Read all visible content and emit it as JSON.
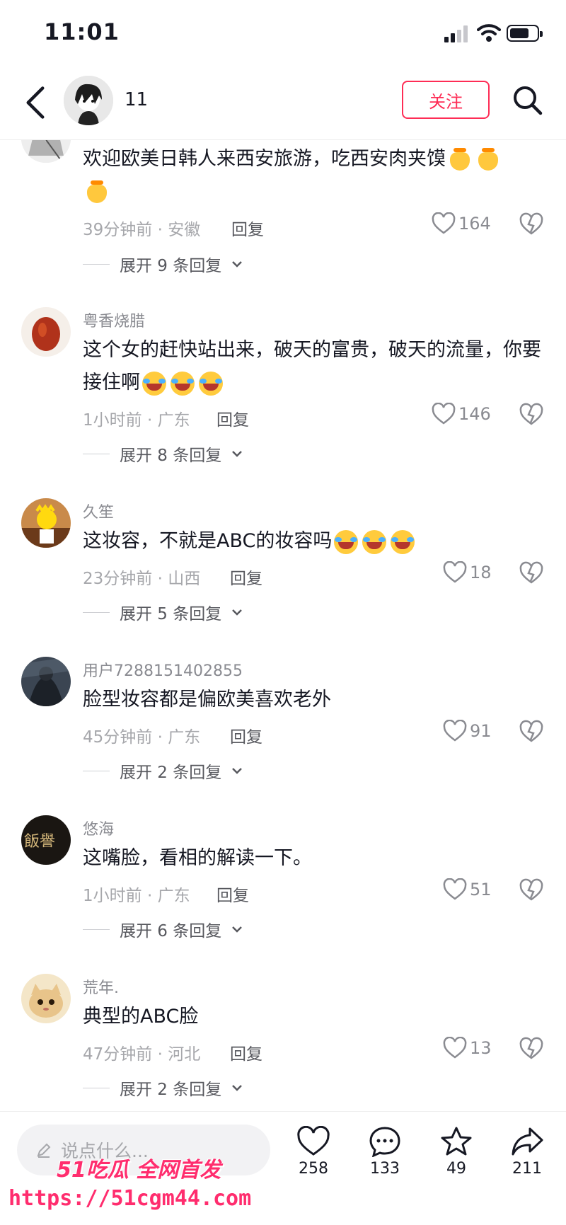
{
  "status": {
    "time": "11:01"
  },
  "header": {
    "username": "11",
    "follow_label": "关注"
  },
  "comments": [
    {
      "username": "",
      "text": "欢迎欧美日韩人来西安旅游，吃西安肉夹馍",
      "emoji": "hands",
      "emoji_count": 3,
      "time": "39分钟前 · 安徽",
      "reply": "回复",
      "likes": "164",
      "expand": "展开 9 条回复"
    },
    {
      "username": "粤香烧腊",
      "text": "这个女的赶快站出来，破天的富贵，破天的流量，你要接住啊",
      "emoji": "laugh",
      "emoji_count": 3,
      "time": "1小时前 · 广东",
      "reply": "回复",
      "likes": "146",
      "expand": "展开 8 条回复"
    },
    {
      "username": "久笙",
      "text": "这妆容，不就是ABC的妆容吗",
      "emoji": "laugh",
      "emoji_count": 3,
      "time": "23分钟前 · 山西",
      "reply": "回复",
      "likes": "18",
      "expand": "展开 5 条回复"
    },
    {
      "username": "用户7288151402855",
      "text": "脸型妆容都是偏欧美喜欢老外",
      "emoji": "",
      "emoji_count": 0,
      "time": "45分钟前 · 广东",
      "reply": "回复",
      "likes": "91",
      "expand": "展开 2 条回复"
    },
    {
      "username": "悠海",
      "text": "这嘴脸，看相的解读一下。",
      "emoji": "",
      "emoji_count": 0,
      "time": "1小时前 · 广东",
      "reply": "回复",
      "likes": "51",
      "expand": "展开 6 条回复"
    },
    {
      "username": "荒年.",
      "text": "典型的ABC脸",
      "emoji": "",
      "emoji_count": 0,
      "time": "47分钟前 · 河北",
      "reply": "回复",
      "likes": "13",
      "expand": "展开 2 条回复"
    }
  ],
  "bottom_bar": {
    "placeholder": "说点什么...",
    "like_count": "258",
    "comment_count": "133",
    "favorite_count": "49",
    "share_count": "211"
  },
  "watermark": {
    "line1": "51吃瓜 全网首发",
    "line2": "https://51cgm44.com"
  },
  "colors": {
    "accent": "#fe2c55",
    "muted": "#a6a7ab"
  }
}
